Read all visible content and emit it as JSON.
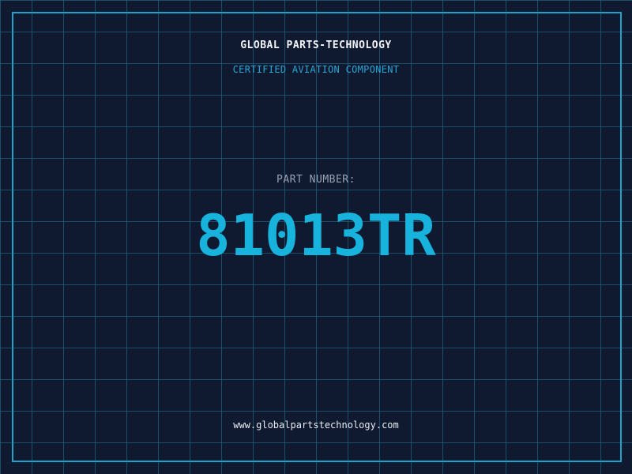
{
  "header": {
    "company_name": "GLOBAL PARTS-TECHNOLOGY",
    "subtitle": "CERTIFIED AVIATION COMPONENT"
  },
  "part": {
    "label": "PART NUMBER:",
    "number": "81013TR"
  },
  "footer": {
    "website": "www.globalpartstechnology.com"
  },
  "colors": {
    "background": "#0f1930",
    "grid": "#28789a",
    "accent": "#17b3dc",
    "frame": "#1fa3c8"
  }
}
